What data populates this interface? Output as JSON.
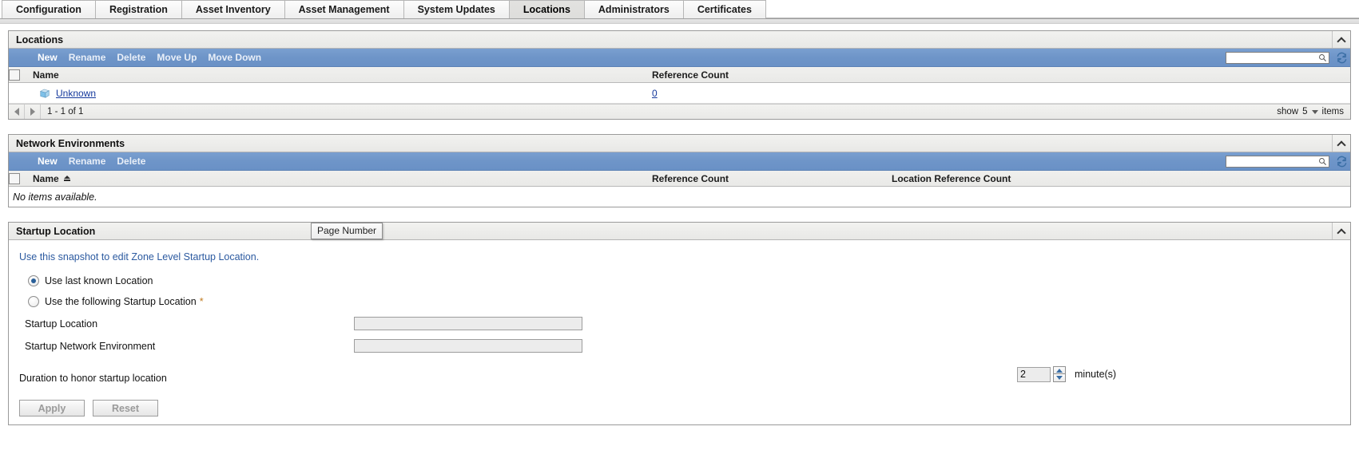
{
  "tabs": [
    {
      "label": "Configuration",
      "active": false
    },
    {
      "label": "Registration",
      "active": false
    },
    {
      "label": "Asset Inventory",
      "active": false
    },
    {
      "label": "Asset Management",
      "active": false
    },
    {
      "label": "System Updates",
      "active": false
    },
    {
      "label": "Locations",
      "active": true
    },
    {
      "label": "Administrators",
      "active": false
    },
    {
      "label": "Certificates",
      "active": false
    }
  ],
  "locations_panel": {
    "title": "Locations",
    "toolbar": {
      "new_label": "New",
      "rename_label": "Rename",
      "delete_label": "Delete",
      "move_up_label": "Move Up",
      "move_down_label": "Move Down",
      "search_value": "",
      "search_placeholder": ""
    },
    "columns": [
      "Name",
      "Reference Count"
    ],
    "rows": [
      {
        "name": "Unknown",
        "reference_count": "0"
      }
    ],
    "pager": {
      "range_text": "1 - 1 of 1",
      "show_label": "show",
      "page_size": "5",
      "items_label": "items"
    }
  },
  "network_panel": {
    "title": "Network Environments",
    "toolbar": {
      "new_label": "New",
      "rename_label": "Rename",
      "delete_label": "Delete",
      "search_value": "",
      "search_placeholder": ""
    },
    "columns": [
      "Name",
      "Reference Count",
      "Location Reference Count"
    ],
    "empty_text": "No items available."
  },
  "tooltip": {
    "text": "Page Number"
  },
  "startup_panel": {
    "title": "Startup Location",
    "description": "Use this snapshot to edit Zone Level Startup Location.",
    "radio_last_known": "Use last known Location",
    "radio_following": "Use the following Startup Location",
    "required_marker": "*",
    "startup_location_label": "Startup Location",
    "startup_location_value": "",
    "startup_network_label": "Startup Network Environment",
    "startup_network_value": "",
    "duration_label": "Duration to honor startup location",
    "duration_value": "2",
    "duration_unit": "minute(s)",
    "apply_label": "Apply",
    "reset_label": "Reset"
  },
  "colors": {
    "toolbar_blue": "#6e95c8",
    "link_blue": "#14389c",
    "desc_blue": "#2c5aa0",
    "spinner_arrow": "#3a6ea5"
  }
}
